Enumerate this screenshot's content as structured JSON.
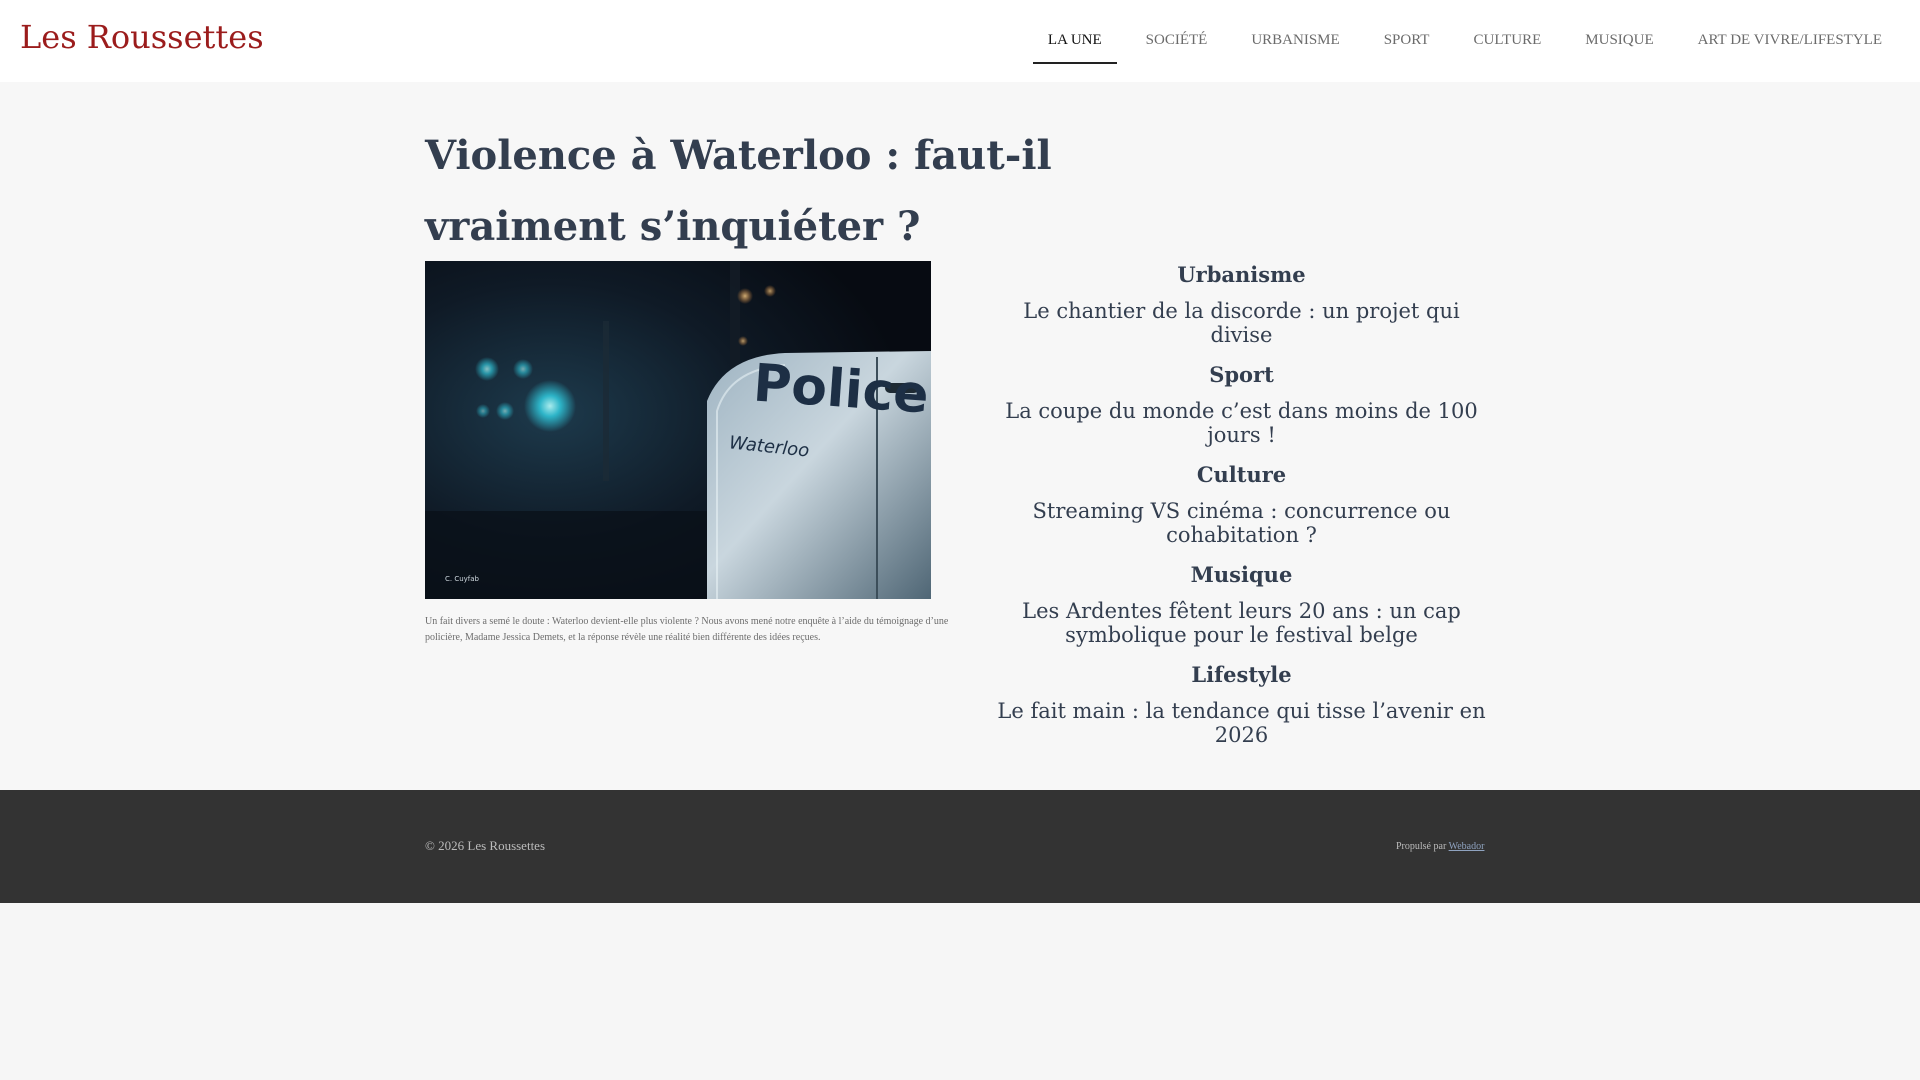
{
  "header": {
    "site_title": "Les Roussettes",
    "nav": [
      {
        "label": "LA UNE",
        "active": true
      },
      {
        "label": "SOCIÉTÉ",
        "active": false
      },
      {
        "label": "URBANISME",
        "active": false
      },
      {
        "label": "SPORT",
        "active": false
      },
      {
        "label": "CULTURE",
        "active": false
      },
      {
        "label": "MUSIQUE",
        "active": false
      },
      {
        "label": "ART DE VIVRE/LIFESTYLE",
        "active": false
      }
    ]
  },
  "article": {
    "title": "Violence à Waterloo : faut-il vraiment s’inquiéter ?",
    "image": {
      "word_police": "Police",
      "word_city": "Waterloo",
      "credit": "C. Cuyfab"
    },
    "caption": "Un fait divers a semé le doute : Waterloo devient-elle plus violente ? Nous avons mené notre enquête à l’aide du témoignage d’une policière, Madame Jessica Demets, et la réponse révèle une réalité bien différente des idées reçues."
  },
  "sidebar": {
    "sections": [
      {
        "heading": "Urbanisme",
        "link": "Le chantier de la discorde : un projet qui divise"
      },
      {
        "heading": "Sport",
        "link": "La coupe du monde c’est dans moins de 100 jours !"
      },
      {
        "heading": "Culture",
        "link": "Streaming VS cinéma : concurrence ou cohabitation ?"
      },
      {
        "heading": "Musique",
        "link": "Les Ardentes fêtent leurs 20 ans : un cap symbolique pour le festival belge"
      },
      {
        "heading": "Lifestyle",
        "link": "Le fait main : la tendance qui tisse l’avenir en 2026"
      }
    ]
  },
  "footer": {
    "copyright": "© 2026 Les Roussettes",
    "powered_prefix": "Propulsé par",
    "powered_link": "Webador"
  },
  "colors": {
    "brand": "#9b1c1c",
    "heading": "#333e4f",
    "footer_bg": "#333333",
    "page_bg": "#f7f7f7"
  }
}
